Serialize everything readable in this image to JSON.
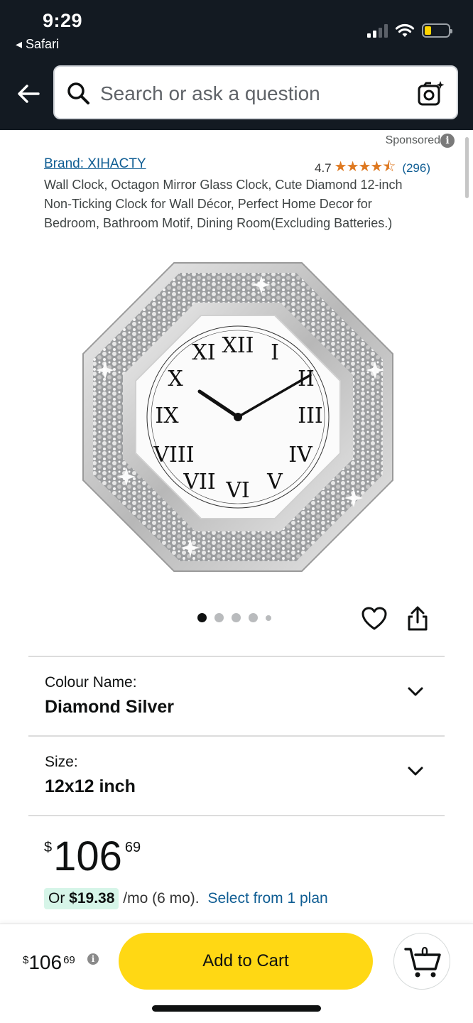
{
  "status_bar": {
    "time": "9:29",
    "back_app": "◂ Safari"
  },
  "search": {
    "placeholder": "Search or ask a question"
  },
  "ad": {
    "sponsored_label": "Sponsored",
    "info_glyph": "i"
  },
  "product": {
    "brand": "Brand: XIHACTY",
    "rating": "4.7",
    "stars_rating": 4.5,
    "stars_glyph": "★★★★⯪",
    "review_count": "(296)",
    "title": "Wall Clock, Octagon Mirror Glass Clock, Cute Diamond 12-inch Non-Ticking Clock for Wall Décor, Perfect Home Decor for Bedroom, Bathroom Motif, Dining Room(Excluding Batteries.)",
    "image_dots": {
      "count": 5,
      "active_index": 0
    }
  },
  "variations": {
    "colour_label": "Colour Name:",
    "colour_value": "Diamond Silver",
    "size_label": "Size:",
    "size_value": "12x12 inch"
  },
  "price": {
    "symbol": "$",
    "whole": "106",
    "fraction": "69"
  },
  "installment": {
    "prefix": "Or ",
    "amount": "$19.38",
    "term": " /mo (6 mo). ",
    "link": "Select from 1 plan"
  },
  "bottom_bar": {
    "price_symbol": "$",
    "price_whole": "106",
    "price_fraction": "69",
    "info_glyph": "i",
    "add_to_cart": "Add to Cart",
    "cart_count": "0"
  },
  "colors": {
    "header_bg": "#131a22",
    "link": "#0f5d93",
    "star": "#de7921",
    "add_to_cart_bg": "#ffd814",
    "installment_bg": "#d6f5e8"
  }
}
